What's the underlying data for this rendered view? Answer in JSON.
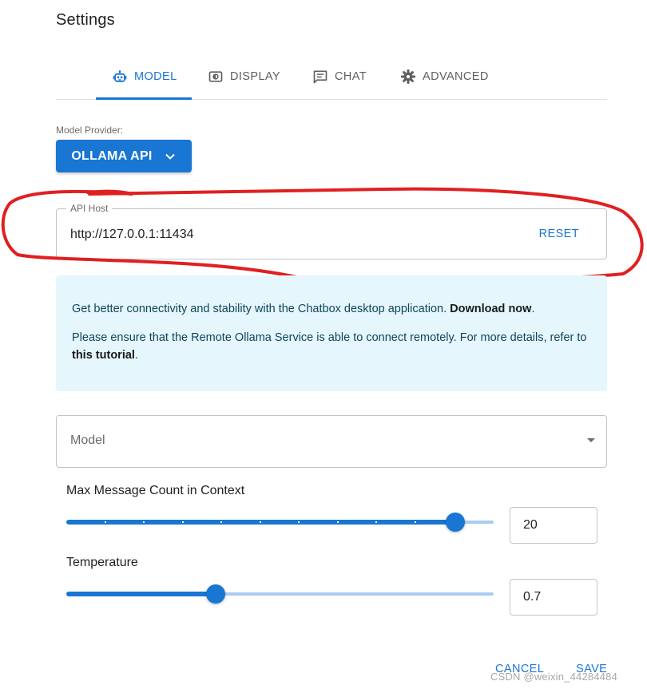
{
  "dialog": {
    "title": "Settings"
  },
  "tabs": [
    {
      "label": "MODEL",
      "icon": "robot-icon",
      "active": true
    },
    {
      "label": "DISPLAY",
      "icon": "display-icon",
      "active": false
    },
    {
      "label": "CHAT",
      "icon": "chat-icon",
      "active": false
    },
    {
      "label": "ADVANCED",
      "icon": "gear-icon",
      "active": false
    }
  ],
  "provider": {
    "label": "Model Provider:",
    "value": "OLLAMA API",
    "icon": "chevron-down-icon"
  },
  "api_host": {
    "label": "API Host",
    "value": "http://127.0.0.1:11434",
    "reset_label": "RESET"
  },
  "info": {
    "line1_text": "Get better connectivity and stability with the Chatbox desktop application. ",
    "line1_link": "Download now",
    "line1_end": ".",
    "line2_text": "Please ensure that the Remote Ollama Service is able to connect remotely. For more details, refer to ",
    "line2_link": "this tutorial",
    "line2_end": "."
  },
  "model_select": {
    "placeholder": "Model",
    "icon": "dropdown-arrow-icon"
  },
  "max_messages": {
    "label": "Max Message Count in Context",
    "value": "20",
    "slider_fraction": 0.91
  },
  "temperature": {
    "label": "Temperature",
    "value": "0.7",
    "slider_fraction": 0.35
  },
  "footer": {
    "cancel_label": "CANCEL",
    "save_label": "SAVE"
  },
  "watermark": "CSDN @weixin_44284484",
  "colors": {
    "accent": "#1976d2",
    "info_bg": "#e5f6fd",
    "annotation": "#e02020"
  }
}
